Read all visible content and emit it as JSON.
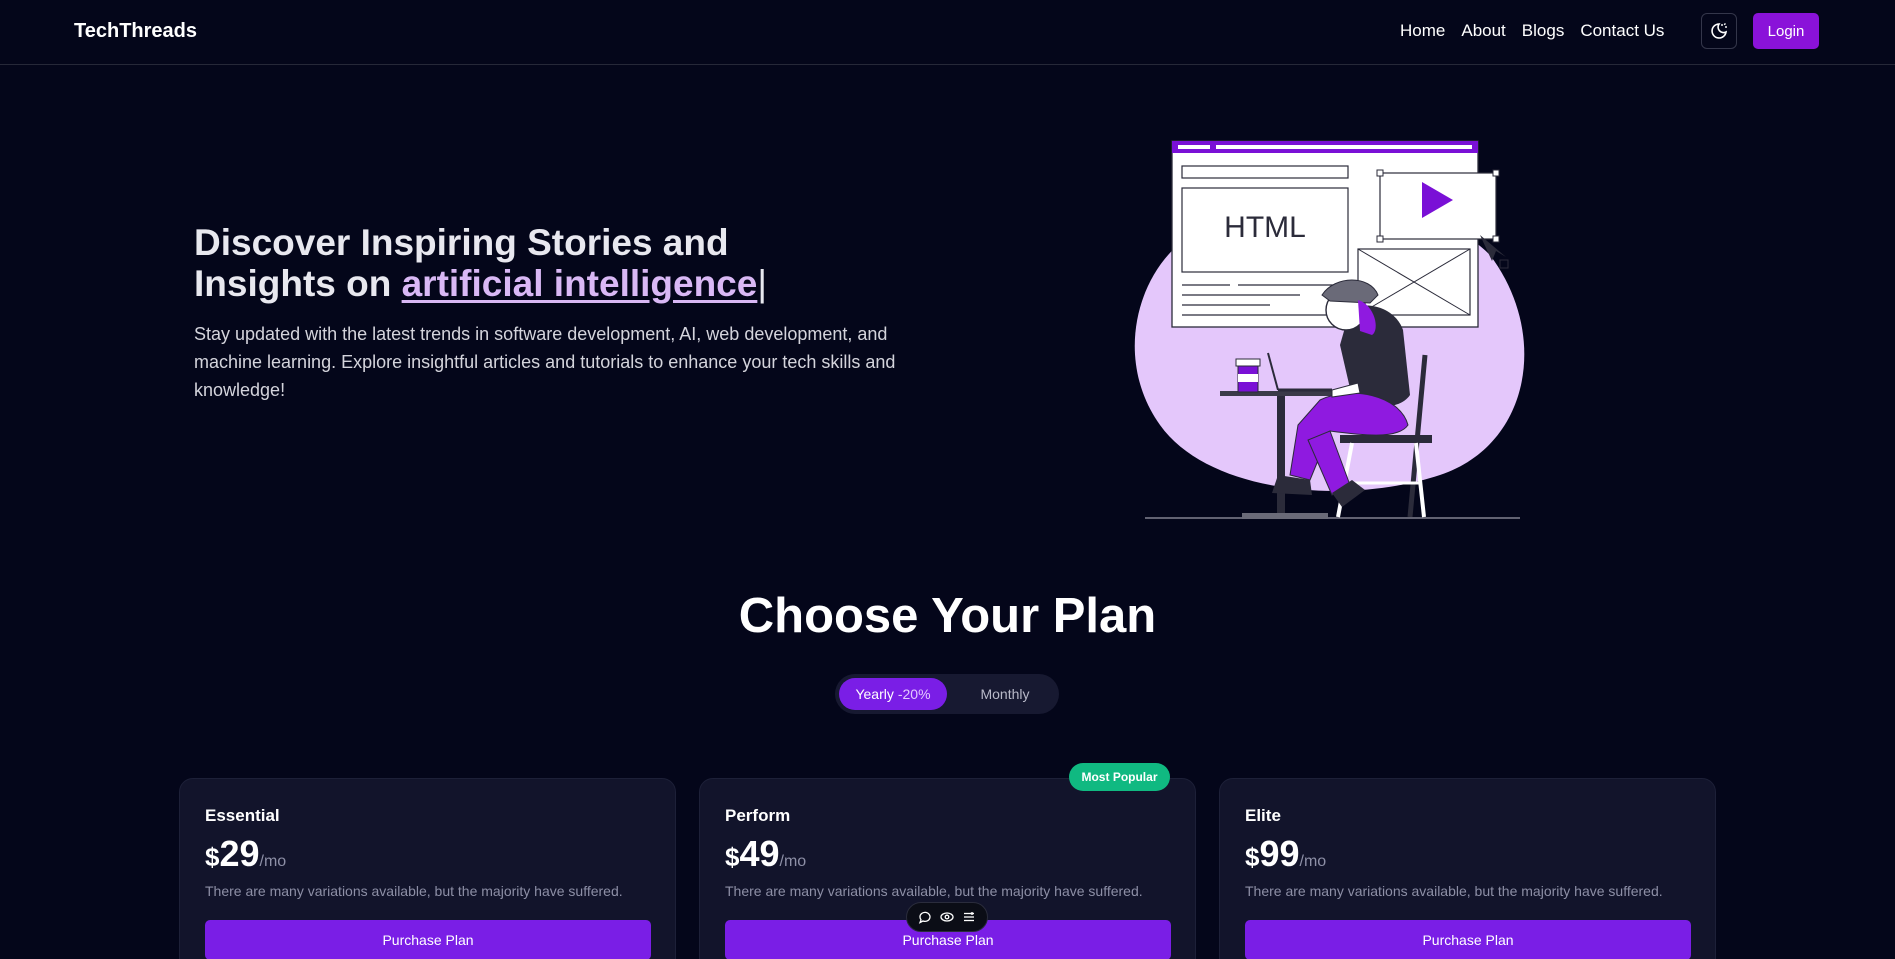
{
  "nav": {
    "brand": "TechThreads",
    "links": [
      "Home",
      "About",
      "Blogs",
      "Contact Us"
    ],
    "theme_icon": "moon-sun-icon",
    "login_label": "Login"
  },
  "hero": {
    "title_part1": "Discover ",
    "title_bold": "Inspiring Stories",
    "title_part2": " and",
    "title_part3": "Insights on ",
    "title_highlight": "artificial intelligence",
    "title_cursor": "|",
    "description": "Stay updated with the latest trends in software development, AI, web development, and machine learning. Explore insightful articles and tutorials to enhance your tech skills and knowledge!",
    "illustration_text": "HTML"
  },
  "plans": {
    "title": "Choose Your Plan",
    "toggle": {
      "yearly_label": "Yearly",
      "yearly_discount": "-20%",
      "monthly_label": "Monthly",
      "selected": "Yearly"
    },
    "badge": "Most Popular",
    "currency": "$",
    "period": "/mo",
    "items": [
      {
        "name": "Essential",
        "price": "29",
        "description": "There are many variations available, but the majority have suffered.",
        "button": "Purchase Plan"
      },
      {
        "name": "Perform",
        "price": "49",
        "description": "There are many variations available, but the majority have suffered.",
        "button": "Purchase Plan"
      },
      {
        "name": "Elite",
        "price": "99",
        "description": "There are many variations available, but the majority have suffered.",
        "button": "Purchase Plan"
      }
    ]
  },
  "floating_toolbar": {
    "icons": [
      "comment-icon",
      "eye-icon",
      "menu-lines-icon"
    ]
  },
  "colors": {
    "background": "#04061a",
    "accent": "#7a1ee6",
    "login": "#8a12d9",
    "badge": "#10b981",
    "card": "#12142b",
    "highlight": "#d9b8f5"
  }
}
